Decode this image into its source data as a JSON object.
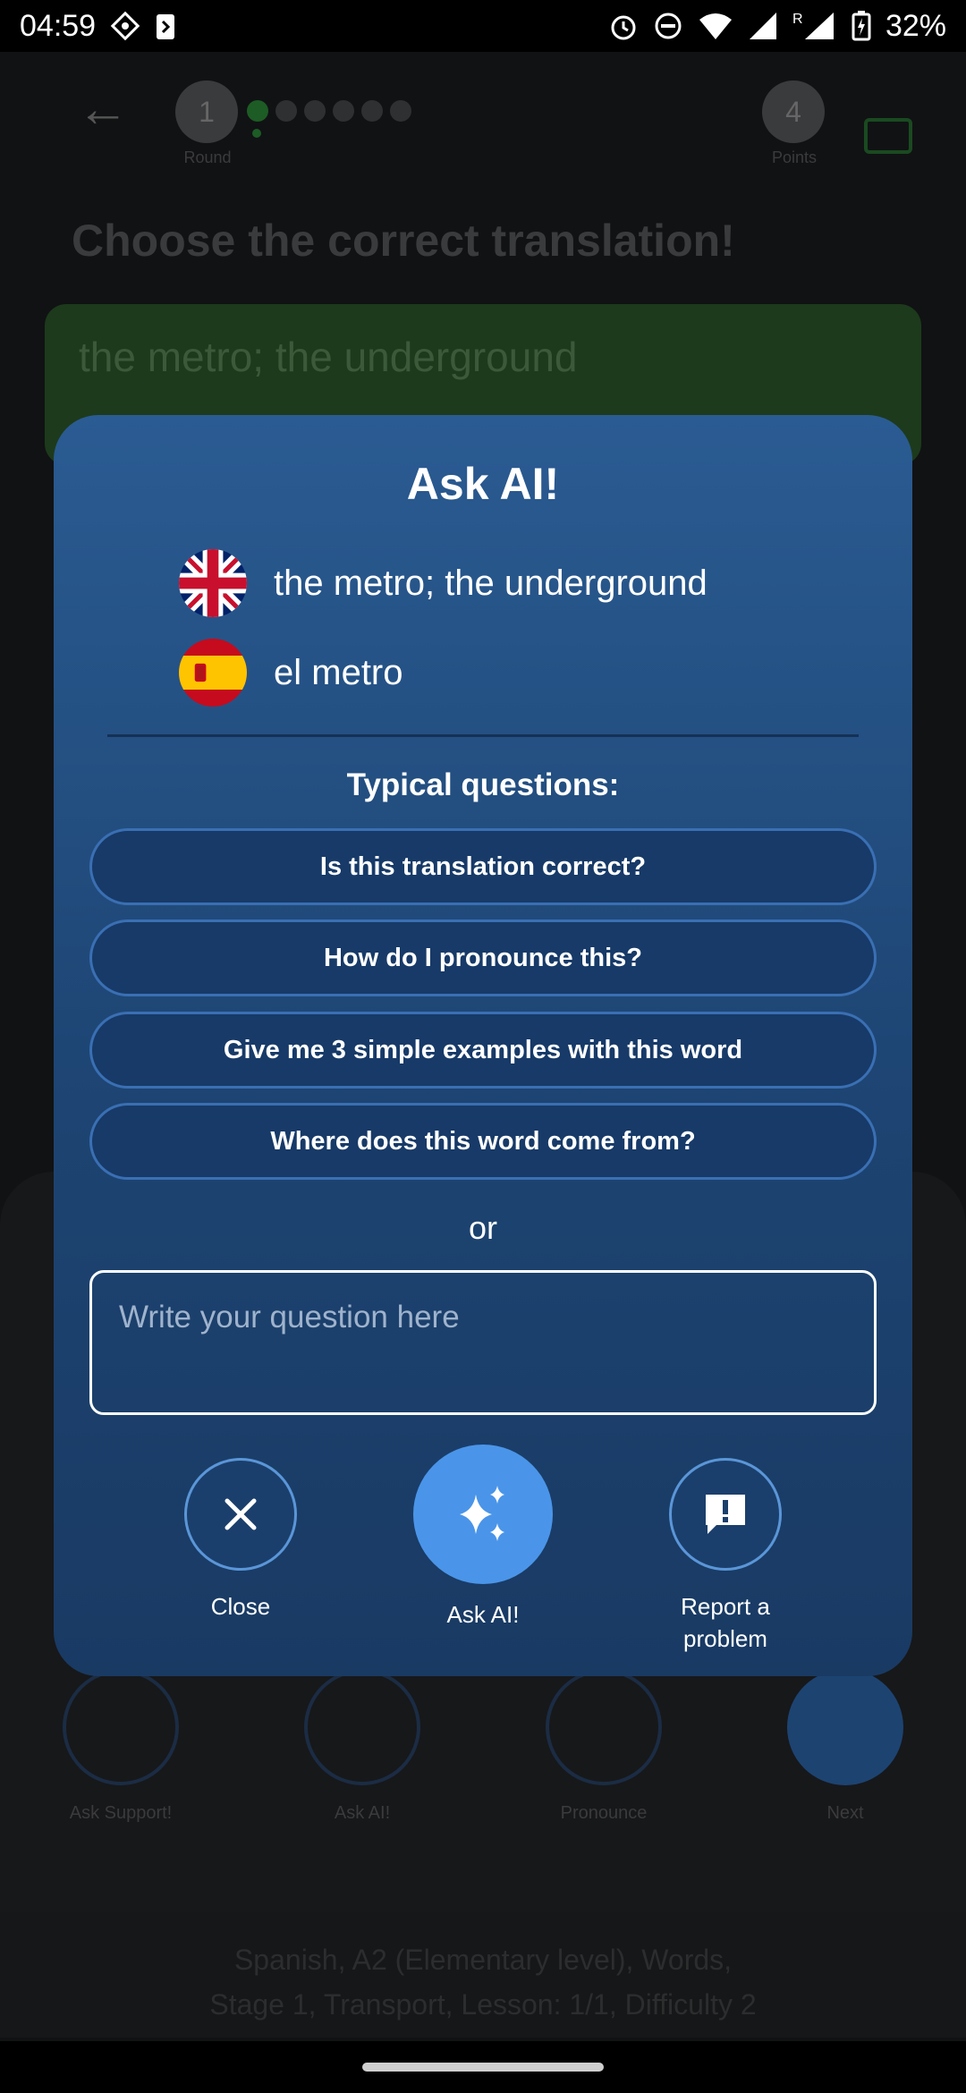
{
  "status_bar": {
    "time": "04:59",
    "battery": "32%"
  },
  "background": {
    "round_number": "1",
    "round_label": "Round",
    "score_number": "4",
    "score_label": "Points",
    "prompt": "Choose the correct translation!",
    "answer": "the metro; the underground",
    "actions": [
      {
        "label": "Ask Support!"
      },
      {
        "label": "Ask AI!"
      },
      {
        "label": "Pronounce"
      },
      {
        "label": "Next"
      }
    ],
    "footer_line1": "Spanish, A2 (Elementary level), Words,",
    "footer_line2": "Stage 1, Transport, Lesson: 1/1, Difficulty 2"
  },
  "modal": {
    "title": "Ask AI!",
    "source": {
      "text": "the metro; the underground",
      "flag": "uk-flag-icon"
    },
    "target": {
      "text": "el metro",
      "flag": "spain-flag-icon"
    },
    "typical_label": "Typical questions:",
    "questions": [
      "Is this translation correct?",
      "How do I pronounce this?",
      "Give me 3 simple examples with this word",
      "Where does this word come from?"
    ],
    "or_label": "or",
    "input": {
      "placeholder": "Write your question here",
      "value": ""
    },
    "actions": {
      "close": "Close",
      "ask": "Ask AI!",
      "report_line1": "Report a",
      "report_line2": "problem"
    }
  },
  "colors": {
    "modal_top": "#2a5b92",
    "modal_bottom": "#193a63",
    "button_fill": "#173a68",
    "button_border": "#3a6fb3",
    "accent": "#4a95e9"
  }
}
